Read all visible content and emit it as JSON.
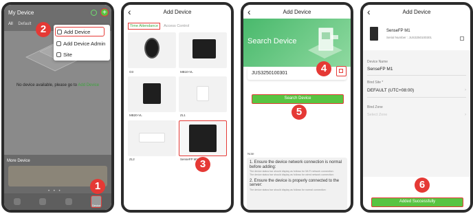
{
  "screen1": {
    "title": "My Device",
    "tabs": [
      "All",
      "Default"
    ],
    "empty_message": "No device available, please go to ",
    "empty_link": "Add Device",
    "more_device": "More Device",
    "nav_active_label": "Device",
    "menu": [
      "Add Device",
      "Add Device Admin",
      "Site"
    ],
    "badges": [
      "1",
      "2"
    ]
  },
  "screen2": {
    "title": "Add Device",
    "tab_active": "Time Attendance",
    "tab_inactive": "Access Control",
    "devices": [
      "O3",
      "MB10-VL",
      "MB20-VL",
      "ZL1",
      "ZL2",
      "SenseFP M1"
    ],
    "badge": "3"
  },
  "screen3": {
    "title": "Add Device",
    "hero": "Search Device",
    "serial": "JUS3250100301",
    "search_button": "Search Device",
    "note_label": "Note",
    "note_1_title": "1. Ensure the device network connection is normal before adding:",
    "note_1_a": "The device status bar should display as follows for Wi-Fi network connection:",
    "note_1_b": "The device status bar should display as follows for wired network connection:",
    "note_2_title": "2. Ensure the device is properly connected to the server:",
    "note_2_a": "The device status bar should display as follows for normal connection:",
    "badges": [
      "4",
      "5"
    ]
  },
  "screen4": {
    "title": "Add Device",
    "device_name": "SenseFP M1",
    "serial_label": "Serial Number :",
    "serial": "JUS3250100301",
    "name_label": "Device Name",
    "name_value": "SenseFP M1",
    "site_label": "Bind Site *",
    "site_value": "DEFAULT (UTC+08:00)",
    "zone_label": "Bind Zone",
    "zone_placeholder": "Select Zone",
    "added_button": "Added Successfully",
    "badge": "6"
  },
  "colors": {
    "accent_green": "#58c442",
    "highlight_red": "#e53935"
  }
}
